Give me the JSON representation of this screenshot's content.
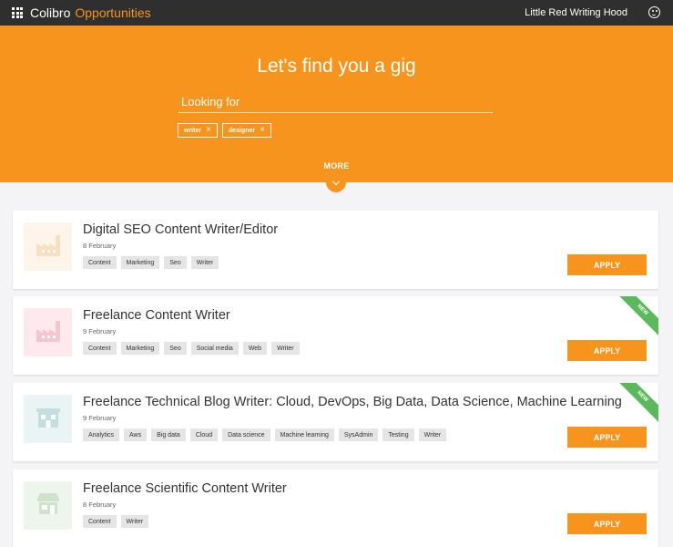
{
  "topbar": {
    "brand": "Colibro",
    "section": "Opportunities",
    "user_name": "Little Red Writing Hood"
  },
  "hero": {
    "title": "Let's find you a gig",
    "search_placeholder": "Looking for",
    "chips": [
      "writer",
      "designer"
    ],
    "more_label": "MORE"
  },
  "colors": {
    "accent": "#f7941d",
    "topbar": "#2f2f2f",
    "new_badge": "#5cb85c",
    "tag_bg": "#e5e5e5"
  },
  "jobs": [
    {
      "title": "Digital SEO Content Writer/Editor",
      "date": "8 February",
      "tags": [
        "Content",
        "Marketing",
        "Seo",
        "Writer"
      ],
      "apply_label": "APPLY",
      "badge": "",
      "logo_icon": "factory-icon",
      "logo_bg": "#fdf4ea",
      "logo_fg": "#f8dfbf"
    },
    {
      "title": "Freelance Content Writer",
      "date": "9 February",
      "tags": [
        "Content",
        "Marketing",
        "Seo",
        "Social media",
        "Web",
        "Writer"
      ],
      "apply_label": "APPLY",
      "badge": "NEW",
      "logo_icon": "factory-icon",
      "logo_bg": "#fde9ee",
      "logo_fg": "#f7c5d1"
    },
    {
      "title": "Freelance Technical Blog Writer: Cloud, DevOps, Big Data, Data Science, Machine Learning",
      "date": "9 February",
      "tags": [
        "Analytics",
        "Aws",
        "Big data",
        "Cloud",
        "Data science",
        "Machine learning",
        "SysAdmin",
        "Testing",
        "Writer"
      ],
      "apply_label": "APPLY",
      "badge": "NEW",
      "logo_icon": "building-icon",
      "logo_bg": "#eaf4f4",
      "logo_fg": "#c3dedd"
    },
    {
      "title": "Freelance Scientific Content Writer",
      "date": "8 February",
      "tags": [
        "Content",
        "Writer"
      ],
      "apply_label": "APPLY",
      "badge": "",
      "logo_icon": "storefront-icon",
      "logo_bg": "#edf5ec",
      "logo_fg": "#cfe3cc"
    }
  ]
}
